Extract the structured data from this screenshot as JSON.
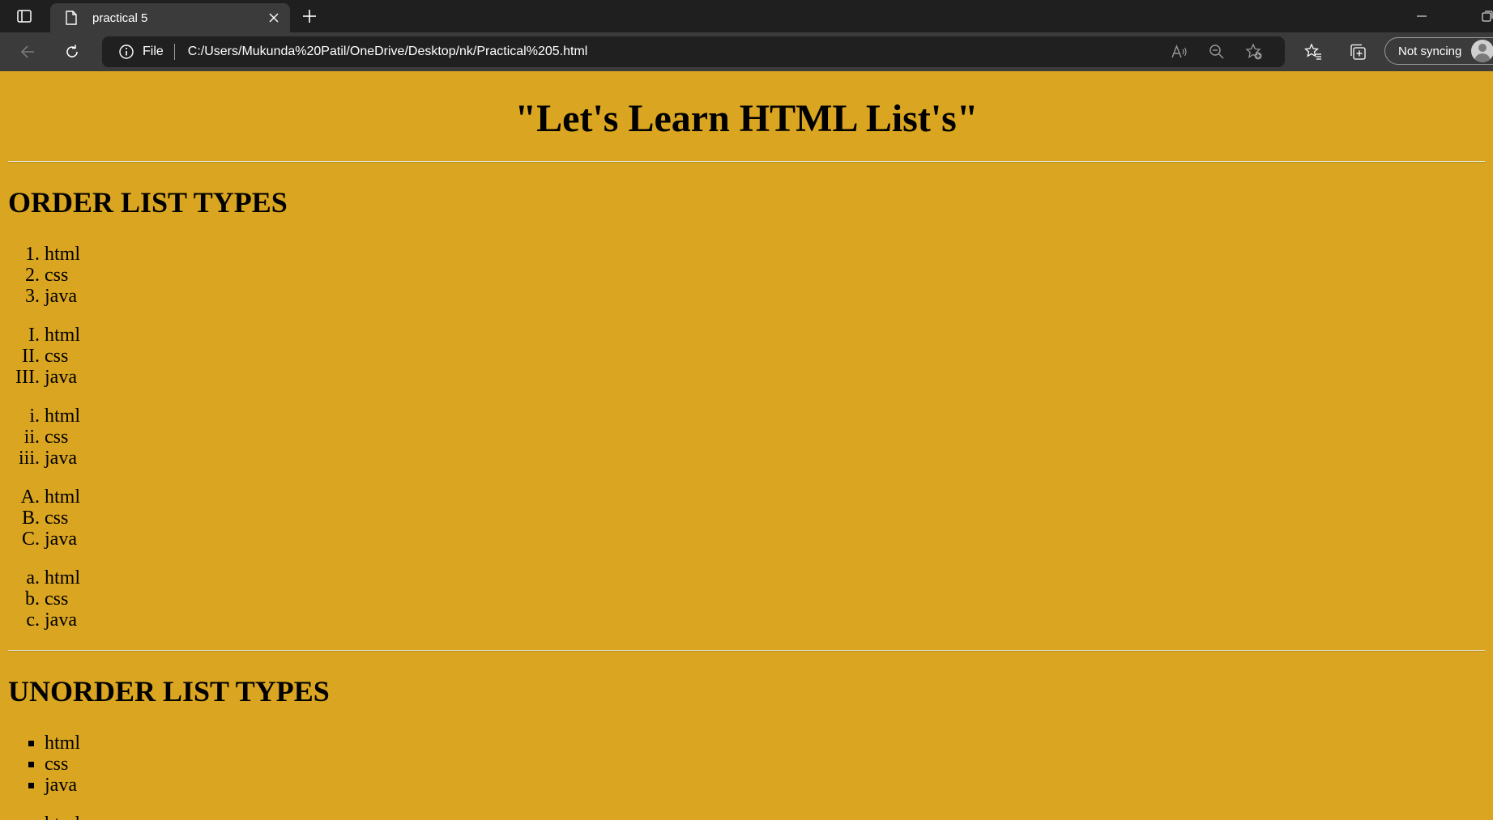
{
  "browser": {
    "tab": {
      "title": "practical 5",
      "icon": "page-icon"
    },
    "address": {
      "scheme": "File",
      "url": "C:/Users/Mukunda%20Patil/OneDrive/Desktop/nk/Practical%205.html"
    },
    "sync_label": "Not syncing"
  },
  "page": {
    "heading": "\"Let's Learn HTML List's\"",
    "background": "#daa520",
    "ordered_section": {
      "title": "ORDER LIST TYPES",
      "lists": [
        {
          "type": "1",
          "items": [
            "html",
            "css",
            "java"
          ]
        },
        {
          "type": "I",
          "items": [
            "html",
            "css",
            "java"
          ]
        },
        {
          "type": "i",
          "items": [
            "html",
            "css",
            "java"
          ]
        },
        {
          "type": "A",
          "items": [
            "html",
            "css",
            "java"
          ]
        },
        {
          "type": "a",
          "items": [
            "html",
            "css",
            "java"
          ]
        }
      ]
    },
    "unordered_section": {
      "title": "UNORDER LIST TYPES",
      "lists": [
        {
          "type": "square",
          "items": [
            "html",
            "css",
            "java"
          ]
        },
        {
          "type": "circle",
          "items": [
            "html"
          ]
        }
      ]
    }
  }
}
